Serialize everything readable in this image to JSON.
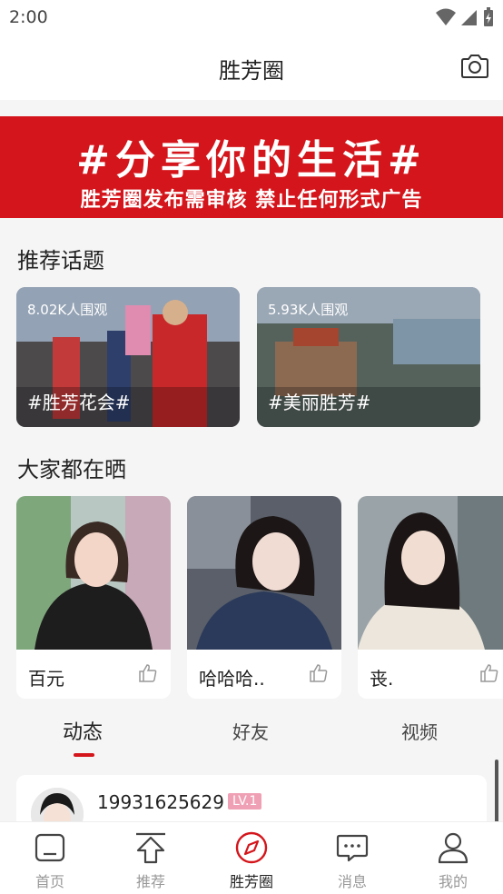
{
  "status": {
    "time": "2:00"
  },
  "header": {
    "title": "胜芳圈"
  },
  "banner": {
    "headline": "#分享你的生活#",
    "notice": "胜芳圈发布需审核 禁止任何形式广告"
  },
  "topics": {
    "title": "推荐话题",
    "items": [
      {
        "views": "8.02K人围观",
        "tag": "#胜芳花会#"
      },
      {
        "views": "5.93K人围观",
        "tag": "#美丽胜芳#"
      }
    ]
  },
  "showcase": {
    "title": "大家都在晒",
    "items": [
      {
        "name": "百元"
      },
      {
        "name": "哈哈哈.."
      },
      {
        "name": "丧."
      }
    ]
  },
  "feed_tabs": [
    {
      "label": "动态"
    },
    {
      "label": "好友"
    },
    {
      "label": "视频"
    }
  ],
  "post": {
    "username": "19931625629",
    "level": "LV.1"
  },
  "bottom_nav": [
    {
      "label": "首页",
      "icon": "home-icon"
    },
    {
      "label": "推荐",
      "icon": "upload-icon"
    },
    {
      "label": "胜芳圈",
      "icon": "compass-icon"
    },
    {
      "label": "消息",
      "icon": "message-icon"
    },
    {
      "label": "我的",
      "icon": "user-icon"
    }
  ],
  "colors": {
    "accent": "#d4151b",
    "badge": "#f0a0b4"
  }
}
